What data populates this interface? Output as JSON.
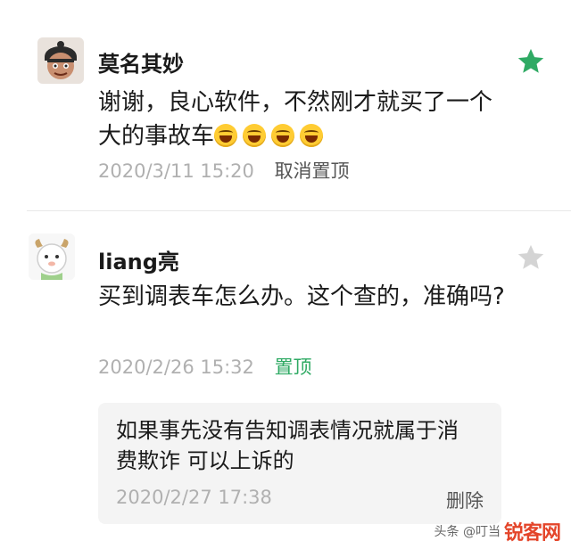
{
  "comments": [
    {
      "name": "莫名其妙",
      "text": "谢谢，良心软件，不然刚才就买了一个大的事故车",
      "emoji_count": 4,
      "time": "2020/3/11 15:20",
      "action": "取消置顶",
      "starred": true
    },
    {
      "name": "liang亮",
      "text": "买到调表车怎么办。这个查的，准确吗?",
      "time": "2020/2/26 15:32",
      "action": "置顶",
      "starred": false,
      "reply": {
        "text": "如果事先没有告知调表情况就属于消费欺诈 可以上诉的",
        "time": "2020/2/27 17:38",
        "delete_label": "删除"
      }
    }
  ],
  "colors": {
    "star_active": "#2faa64",
    "star_inactive": "#d4d4d4",
    "pin_action": "#2faa64",
    "meta_text": "#b0b0b0"
  },
  "icons": {
    "star": "star-icon",
    "emoji": "grinning-squint-emoji-icon"
  },
  "watermark": {
    "logo": "锐客网",
    "sub": "头条 @叮当"
  }
}
